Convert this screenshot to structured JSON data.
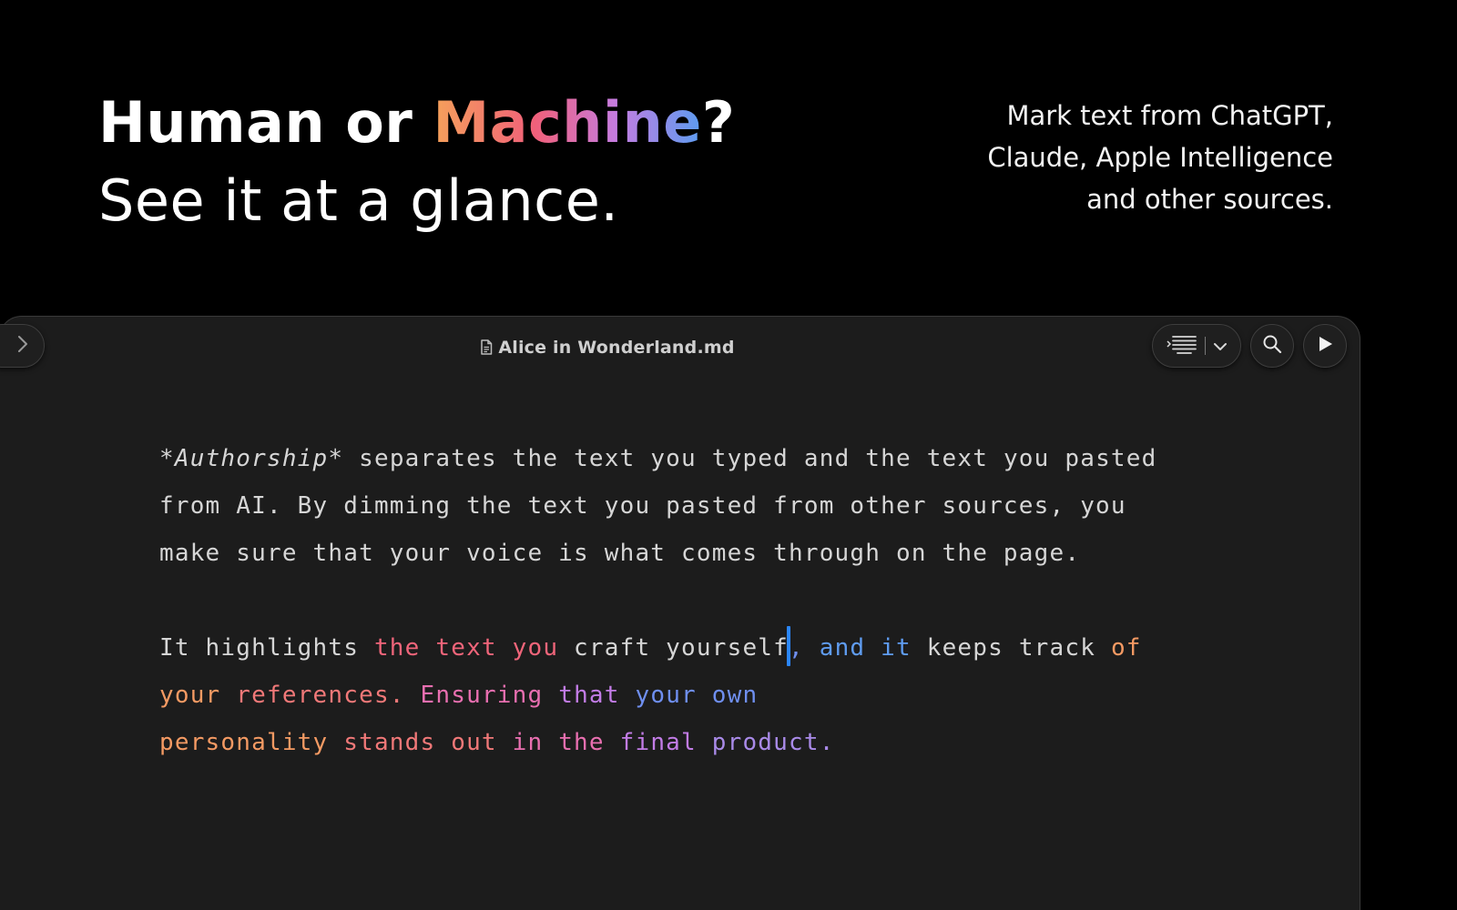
{
  "hero": {
    "title_prefix": "Human or ",
    "title_highlight": "Machine",
    "title_suffix": "?",
    "subtitle": "See it at a glance."
  },
  "tagline": {
    "lines": [
      "Mark text from ChatGPT,",
      "Claude, Apple Intelligence",
      "and other sources."
    ]
  },
  "window": {
    "doc_title": "Alice in Wonderland.md"
  },
  "icons": {
    "sidebar_toggle": "chevron-right-icon",
    "doc": "document-icon",
    "layout": "align-lines-icon",
    "dropdown": "chevron-down-icon",
    "search": "search-icon",
    "play": "play-icon"
  },
  "colors": {
    "gradient": [
      "#f5a15a",
      "#f0607a",
      "#c57ce0",
      "#5c9cf0"
    ],
    "caret": "#2b86ff",
    "editor_bg": "#1c1c1c",
    "page_bg": "#000000"
  },
  "editor": {
    "p1": {
      "marker_open": "*",
      "emphasis": "Authorship",
      "marker_close": "*",
      "rest": " separates the text you typed and the text you pasted from AI. By dimming the text you pasted from other sources, you make sure that your voice is what comes through on the page."
    },
    "p2": {
      "s1": "It highlights ",
      "s2": "the text you",
      "s3": " craft yourself",
      "s4": ",",
      "s5": " and it",
      "s6": " keeps track ",
      "s7": "of your",
      "s8": " references.",
      "s9": " Ensuring",
      "s10": " that",
      "s11": " your own",
      "s12": "personality",
      "s13": " stands out",
      "s14": " in the",
      "s15": " final",
      "s16": " product."
    }
  }
}
